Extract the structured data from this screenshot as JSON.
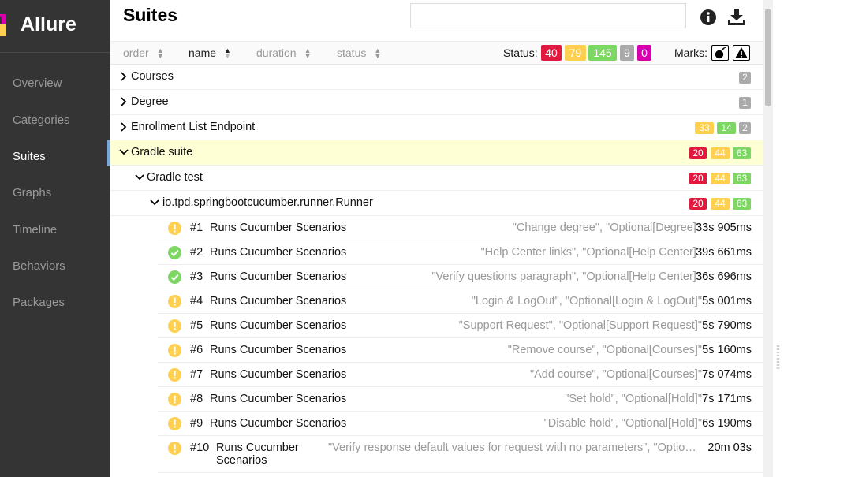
{
  "app": {
    "name": "Allure"
  },
  "sidebar": {
    "items": [
      {
        "label": "Overview"
      },
      {
        "label": "Categories"
      },
      {
        "label": "Suites"
      },
      {
        "label": "Graphs"
      },
      {
        "label": "Timeline"
      },
      {
        "label": "Behaviors"
      },
      {
        "label": "Packages"
      }
    ],
    "active": "Suites"
  },
  "header": {
    "title": "Suites",
    "search_placeholder": "",
    "search_value": ""
  },
  "sortbar": {
    "order": "order",
    "name": "name",
    "duration": "duration",
    "status": "status",
    "status_label": "Status:",
    "marks_label": "Marks:",
    "status_counts": [
      "40",
      "79",
      "145",
      "9",
      "0"
    ]
  },
  "colors": {
    "failed": "#e2193f",
    "broken": "#ffd050",
    "passed": "#7ed665",
    "skipped": "#aaaaaa",
    "unknown": "#d400ae",
    "sidebar_bg": "#343434",
    "selected_row": "#ffffd6",
    "selected_bar": "#7aa7d8"
  },
  "tree": {
    "courses": {
      "label": "Courses",
      "counts": [
        "2"
      ]
    },
    "degree": {
      "label": "Degree",
      "counts": [
        "1"
      ]
    },
    "enrollment": {
      "label": "Enrollment List Endpoint",
      "counts": [
        "33",
        "14",
        "2"
      ]
    },
    "gradle_suite": {
      "label": "Gradle suite",
      "counts": [
        "20",
        "44",
        "63"
      ]
    },
    "gradle_test": {
      "label": "Gradle test",
      "counts": [
        "20",
        "44",
        "63"
      ]
    },
    "runner": {
      "label": "io.tpd.springbootcucumber.runner.Runner",
      "counts": [
        "20",
        "44",
        "63"
      ]
    }
  },
  "tests": [
    {
      "num": "#1",
      "name": "Runs Cucumber Scenarios",
      "params": "\"Change degree\", \"Optional[Degree]\"",
      "duration": "33s 905ms",
      "status": "broken"
    },
    {
      "num": "#2",
      "name": "Runs Cucumber Scenarios",
      "params": "\"Help Center links\", \"Optional[Help Center]\"",
      "duration": "39s 661ms",
      "status": "passed"
    },
    {
      "num": "#3",
      "name": "Runs Cucumber Scenarios",
      "params": "\"Verify questions paragraph\", \"Optional[Help Center]\"",
      "duration": "36s 696ms",
      "status": "passed"
    },
    {
      "num": "#4",
      "name": "Runs Cucumber Scenarios",
      "params": "\"Login & LogOut\", \"Optional[Login & LogOut]\"",
      "duration": "5s 001ms",
      "status": "broken"
    },
    {
      "num": "#5",
      "name": "Runs Cucumber Scenarios",
      "params": "\"Support Request\", \"Optional[Support Request]\"",
      "duration": "5s 790ms",
      "status": "broken"
    },
    {
      "num": "#6",
      "name": "Runs Cucumber Scenarios",
      "params": "\"Remove course\", \"Optional[Courses]\"",
      "duration": "5s 160ms",
      "status": "broken"
    },
    {
      "num": "#7",
      "name": "Runs Cucumber Scenarios",
      "params": "\"Add course\", \"Optional[Courses]\"",
      "duration": "7s 074ms",
      "status": "broken"
    },
    {
      "num": "#8",
      "name": "Runs Cucumber Scenarios",
      "params": "\"Set hold\", \"Optional[Hold]\"",
      "duration": "7s 171ms",
      "status": "broken"
    },
    {
      "num": "#9",
      "name": "Runs Cucumber Scenarios",
      "params": "\"Disable hold\", \"Optional[Hold]\"",
      "duration": "6s 190ms",
      "status": "broken"
    },
    {
      "num": "#10",
      "name_line1": "Runs Cucumber",
      "name_line2": "Scenarios",
      "params": "\"Verify response default values for request with no parameters\", \"Optional[…",
      "duration": "20m 03s",
      "status": "broken"
    }
  ]
}
